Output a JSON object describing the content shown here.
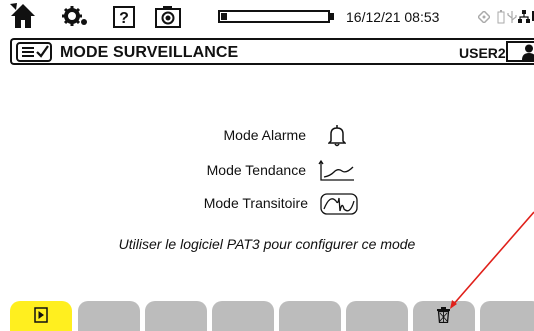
{
  "status_bar": {
    "icons": [
      "home-icon",
      "settings-gear-icon",
      "help-icon",
      "camera-icon"
    ],
    "battery_level": 0.06,
    "datetime": "16/12/21 08:53",
    "indicators": [
      "gps-indicator-icon",
      "battery-small-icon",
      "usb-icon",
      "network-icon",
      "memory-icon"
    ]
  },
  "title_bar": {
    "menu_icon": "checklist-menu-icon",
    "title": "MODE SURVEILLANCE",
    "user": "USER2",
    "user_icon": "user-avatar-icon"
  },
  "modes": [
    {
      "label": "Mode Alarme",
      "icon": "bell-icon"
    },
    {
      "label": "Mode Tendance",
      "icon": "trend-chart-icon"
    },
    {
      "label": "Mode Transitoire",
      "icon": "transient-wave-icon"
    }
  ],
  "note": "Utiliser le logiciel PAT3 pour configurer ce mode",
  "soft_keys": [
    {
      "icon": "play-icon",
      "active": true
    },
    {
      "icon": "",
      "active": false
    },
    {
      "icon": "",
      "active": false
    },
    {
      "icon": "",
      "active": false
    },
    {
      "icon": "",
      "active": false
    },
    {
      "icon": "",
      "active": false
    },
    {
      "icon": "trash-icon",
      "active": false
    },
    {
      "icon": "",
      "active": false
    }
  ],
  "colors": {
    "active_key": "#ffef1f",
    "inactive_key": "#bcbcbc",
    "annotation_arrow": "#e0201a"
  }
}
